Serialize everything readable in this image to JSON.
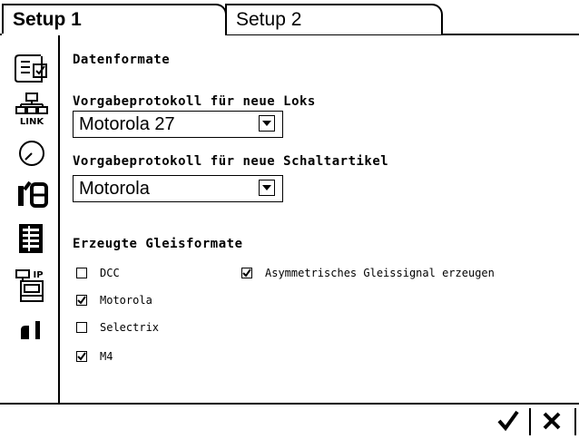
{
  "tabs": [
    {
      "label": "Setup 1",
      "active": true
    },
    {
      "label": "Setup 2",
      "active": false
    }
  ],
  "sidebar": {
    "items": [
      {
        "icon": "document-edit-icon"
      },
      {
        "icon": "network-link-icon",
        "label": "LINK"
      },
      {
        "icon": "gauge-icon"
      },
      {
        "icon": "io-icon",
        "label": "I/O"
      },
      {
        "icon": "list-icon",
        "active": true
      },
      {
        "icon": "ip-computer-icon",
        "label": "IP"
      },
      {
        "icon": "locomotive-icon"
      }
    ]
  },
  "section": {
    "title": "Datenformate",
    "default_loco_label": "Vorgabeprotokoll für neue Loks",
    "default_loco_value": "Motorola 27",
    "default_switch_label": "Vorgabeprotokoll für neue Schaltartikel",
    "default_switch_value": "Motorola",
    "generated_title": "Erzeugte Gleisformate",
    "formats": [
      {
        "label": "DCC",
        "checked": false
      },
      {
        "label": "Motorola",
        "checked": true
      },
      {
        "label": "Selectrix",
        "checked": false
      },
      {
        "label": "M4",
        "checked": true
      }
    ],
    "asym": {
      "label": "Asymmetrisches Gleissignal erzeugen",
      "checked": true
    }
  },
  "footer": {
    "ok_icon": "checkmark-icon",
    "cancel_icon": "close-icon"
  }
}
